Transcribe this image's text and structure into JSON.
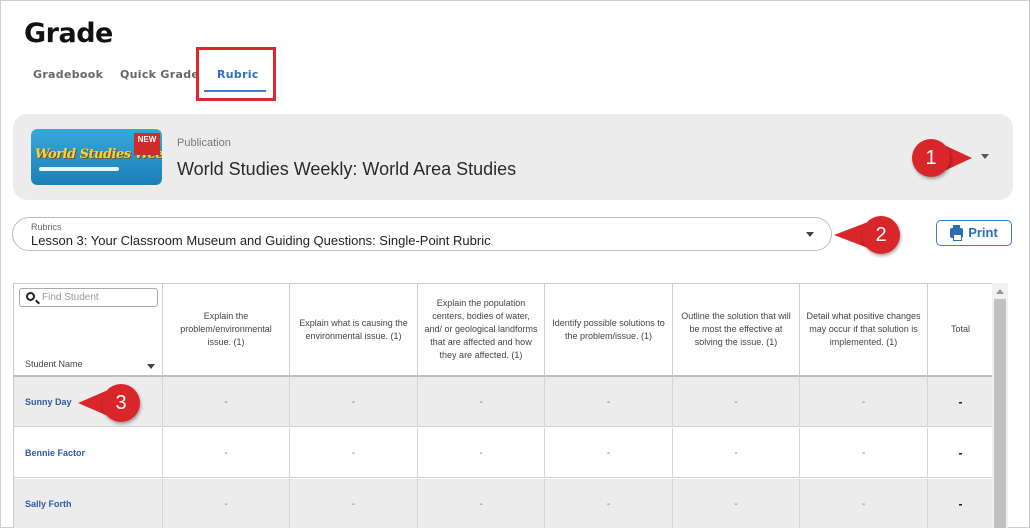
{
  "page": {
    "title": "Grade"
  },
  "tabs": [
    {
      "label": "Gradebook"
    },
    {
      "label": "Quick Grade"
    },
    {
      "label": "Rubric",
      "active": true
    }
  ],
  "publication": {
    "label": "Publication",
    "title": "World Studies Weekly: World Area Studies",
    "thumbnail": {
      "logo_text": "World Studies Weekly",
      "badge": "NEW"
    }
  },
  "rubrics": {
    "label": "Rubrics",
    "value": "Lesson 3: Your Classroom Museum and Guiding Questions: Single-Point Rubric"
  },
  "print": {
    "label": "Print",
    "icon": "printer-icon"
  },
  "callouts": [
    "1",
    "2",
    "3"
  ],
  "table": {
    "search_placeholder": "Find Student",
    "student_col_label": "Student Name",
    "columns": [
      "Explain the problem/environmental issue. (1)",
      "Explain what is causing the environmental issue. (1)",
      "Explain the population centers, bodies of water, and/ or geological landforms that are affected and how they are affected. (1)",
      "Identify possible solutions to the problem/issue. (1)",
      "Outline the solution that will be most the effective at solving the issue. (1)",
      "Detail what positive changes may occur if that solution is implemented. (1)",
      "Total"
    ],
    "rows": [
      {
        "name": "Sunny Day",
        "cells": [
          "-",
          "-",
          "-",
          "-",
          "-",
          "-"
        ],
        "total": "-"
      },
      {
        "name": "Bennie Factor",
        "cells": [
          "-",
          "-",
          "-",
          "-",
          "-",
          "-"
        ],
        "total": "-"
      },
      {
        "name": "Sally Forth",
        "cells": [
          "-",
          "-",
          "-",
          "-",
          "-",
          "-"
        ],
        "total": "-"
      }
    ]
  },
  "colors": {
    "accent": "#2f6fbd",
    "callout": "#d9262b",
    "highlight": "#e0262d",
    "row_alt": "#ececec"
  }
}
